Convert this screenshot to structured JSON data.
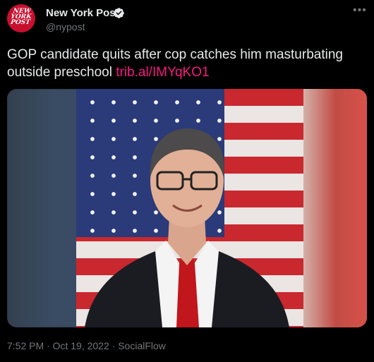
{
  "account": {
    "name": "New York Post",
    "handle": "@nypost",
    "avatar_text": "NEW YORK POST"
  },
  "tweet": {
    "text": "GOP candidate quits after cop catches him masturbating outside preschool",
    "link": "trib.al/IMYqKO1"
  },
  "meta": {
    "time": "7:52 PM",
    "date": "Oct 19, 2022",
    "source": "SocialFlow",
    "separator": " · "
  },
  "icons": {
    "verified": "verified-badge-icon",
    "more": "more-options-icon"
  },
  "colors": {
    "background": "#000000",
    "link": "#f91880",
    "muted": "#71767b",
    "avatar_bg": "#c8102e"
  }
}
